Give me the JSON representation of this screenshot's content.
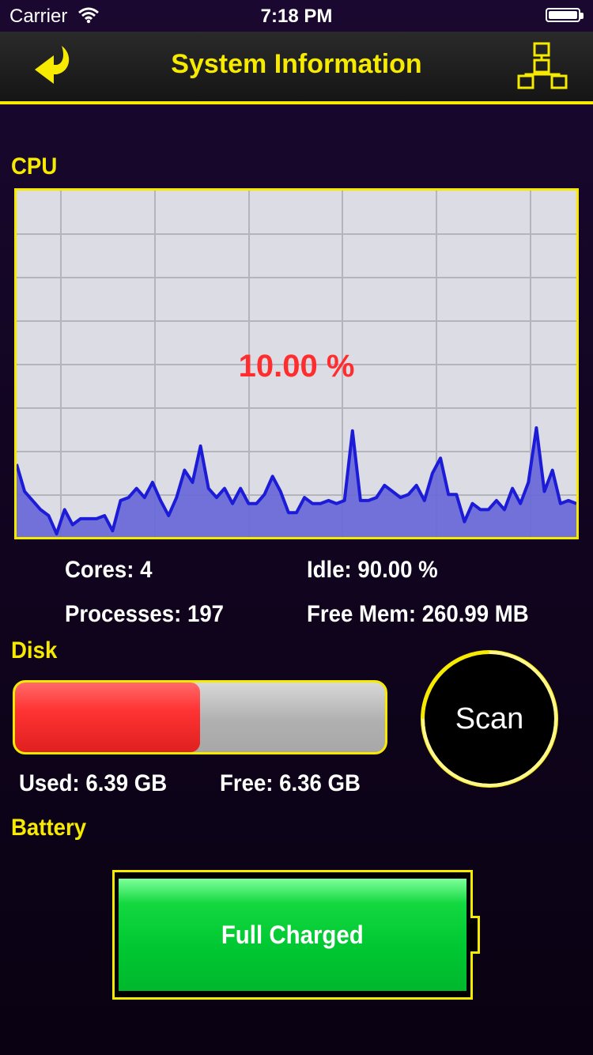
{
  "status_bar": {
    "carrier": "Carrier",
    "time": "7:18 PM"
  },
  "nav": {
    "title": "System Information",
    "back_icon": "back-arrow-icon",
    "network_icon": "network-hierarchy-icon"
  },
  "accent_color": "#f5ea00",
  "cpu": {
    "label": "CPU",
    "usage_text": "10.00 %",
    "cores": "Cores: 4",
    "idle": "Idle: 90.00 %",
    "processes": "Processes: 197",
    "free_mem": "Free Mem: 260.99 MB"
  },
  "chart_data": {
    "type": "area",
    "title": "",
    "xlabel": "",
    "ylabel": "",
    "ylim": [
      0,
      100
    ],
    "grid": true,
    "series": [
      {
        "values": [
          23,
          14,
          11,
          8,
          6,
          0,
          8,
          3,
          5,
          5,
          5,
          6,
          1,
          11,
          12,
          15,
          12,
          17,
          11,
          6,
          12,
          21,
          17,
          29,
          15,
          12,
          15,
          10,
          15,
          10,
          10,
          13,
          19,
          14,
          7,
          7,
          12,
          10,
          10,
          11,
          10,
          11,
          34,
          11,
          11,
          12,
          16,
          14,
          12,
          13,
          16,
          11,
          20,
          25,
          13,
          13,
          4,
          10,
          8,
          8,
          11,
          8,
          15,
          10,
          17,
          35,
          14,
          21,
          10,
          11,
          10
        ]
      }
    ]
  },
  "disk": {
    "label": "Disk",
    "used": "Used: 6.39 GB",
    "free": "Free: 6.36 GB",
    "used_fraction": 0.501
  },
  "scan_button": {
    "label": "Scan"
  },
  "battery": {
    "label": "Battery",
    "status": "Full Charged",
    "level_fraction": 1.0
  }
}
